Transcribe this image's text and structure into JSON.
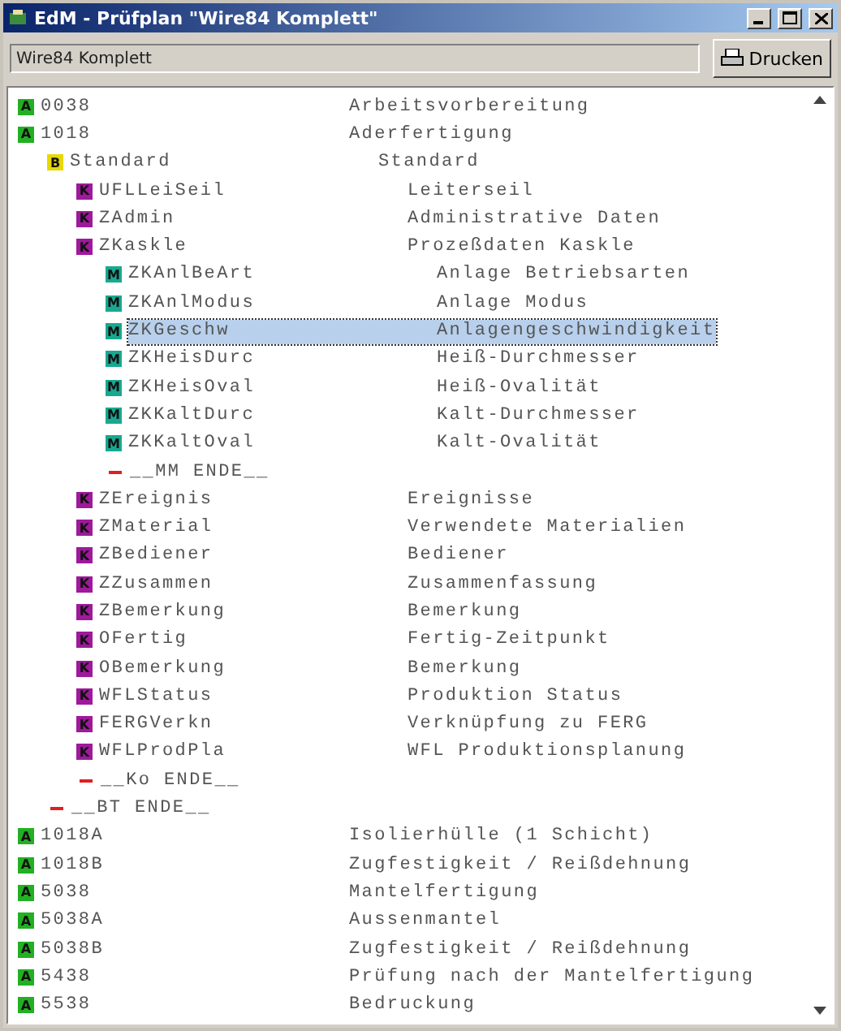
{
  "window": {
    "title": "EdM - Prüfplan \"Wire84 Komplett\""
  },
  "toolbar": {
    "field_value": "Wire84 Komplett",
    "print_button": "Drucken"
  },
  "tree": [
    {
      "kind": "node",
      "badge": "A",
      "color": "#22b022",
      "name": "0038",
      "description": "Arbeitsvorbereitung",
      "selected": false
    },
    {
      "kind": "node",
      "badge": "A",
      "color": "#22b022",
      "name": "1018",
      "description": "Aderfertigung",
      "selected": false,
      "children": [
        {
          "kind": "node",
          "badge": "B",
          "color": "#e6d800",
          "name": "Standard",
          "description": "Standard",
          "selected": false,
          "children": [
            {
              "kind": "node",
              "badge": "K",
              "color": "#a0189c",
              "name": "UFLLeiSeil",
              "description": "Leiterseil",
              "selected": false
            },
            {
              "kind": "node",
              "badge": "K",
              "color": "#a0189c",
              "name": "ZAdmin",
              "description": "Administrative Daten",
              "selected": false
            },
            {
              "kind": "node",
              "badge": "K",
              "color": "#a0189c",
              "name": "ZKaskle",
              "description": "Prozeßdaten Kaskle",
              "selected": false,
              "children": [
                {
                  "kind": "node",
                  "badge": "M",
                  "color": "#18a890",
                  "name": "ZKAnlBeArt",
                  "description": "Anlage Betriebsarten",
                  "selected": false
                },
                {
                  "kind": "node",
                  "badge": "M",
                  "color": "#18a890",
                  "name": "ZKAnlModus",
                  "description": "Anlage Modus",
                  "selected": false
                },
                {
                  "kind": "node",
                  "badge": "M",
                  "color": "#18a890",
                  "name": "ZKGeschw",
                  "description": "Anlagengeschwindigkeit",
                  "selected": true
                },
                {
                  "kind": "node",
                  "badge": "M",
                  "color": "#18a890",
                  "name": "ZKHeisDurc",
                  "description": "Heiß-Durchmesser",
                  "selected": false
                },
                {
                  "kind": "node",
                  "badge": "M",
                  "color": "#18a890",
                  "name": "ZKHeisOval",
                  "description": "Heiß-Ovalität",
                  "selected": false
                },
                {
                  "kind": "node",
                  "badge": "M",
                  "color": "#18a890",
                  "name": "ZKKaltDurc",
                  "description": "Kalt-Durchmesser",
                  "selected": false
                },
                {
                  "kind": "node",
                  "badge": "M",
                  "color": "#18a890",
                  "name": "ZKKaltOval",
                  "description": "Kalt-Ovalität",
                  "selected": false
                },
                {
                  "kind": "end",
                  "name": "__MM ENDE__",
                  "selected": false
                }
              ]
            },
            {
              "kind": "node",
              "badge": "K",
              "color": "#a0189c",
              "name": "ZEreignis",
              "description": "Ereignisse",
              "selected": false
            },
            {
              "kind": "node",
              "badge": "K",
              "color": "#a0189c",
              "name": "ZMaterial",
              "description": "Verwendete Materialien",
              "selected": false
            },
            {
              "kind": "node",
              "badge": "K",
              "color": "#a0189c",
              "name": "ZBediener",
              "description": "Bediener",
              "selected": false
            },
            {
              "kind": "node",
              "badge": "K",
              "color": "#a0189c",
              "name": "ZZusammen",
              "description": "Zusammenfassung",
              "selected": false
            },
            {
              "kind": "node",
              "badge": "K",
              "color": "#a0189c",
              "name": "ZBemerkung",
              "description": "Bemerkung",
              "selected": false
            },
            {
              "kind": "node",
              "badge": "K",
              "color": "#a0189c",
              "name": "OFertig",
              "description": "Fertig-Zeitpunkt",
              "selected": false
            },
            {
              "kind": "node",
              "badge": "K",
              "color": "#a0189c",
              "name": "OBemerkung",
              "description": "Bemerkung",
              "selected": false
            },
            {
              "kind": "node",
              "badge": "K",
              "color": "#a0189c",
              "name": "WFLStatus",
              "description": "Produktion Status",
              "selected": false
            },
            {
              "kind": "node",
              "badge": "K",
              "color": "#a0189c",
              "name": "FERGVerkn",
              "description": "Verknüpfung zu FERG",
              "selected": false
            },
            {
              "kind": "node",
              "badge": "K",
              "color": "#a0189c",
              "name": "WFLProdPla",
              "description": "WFL Produktionsplanung",
              "selected": false
            },
            {
              "kind": "end",
              "name": "__Ko ENDE__",
              "selected": false
            }
          ]
        },
        {
          "kind": "end",
          "name": "__BT ENDE__",
          "selected": false
        }
      ]
    },
    {
      "kind": "node",
      "badge": "A",
      "color": "#22b022",
      "name": "1018A",
      "description": "Isolierhülle (1 Schicht)",
      "selected": false
    },
    {
      "kind": "node",
      "badge": "A",
      "color": "#22b022",
      "name": "1018B",
      "description": "Zugfestigkeit / Reißdehnung",
      "selected": false
    },
    {
      "kind": "node",
      "badge": "A",
      "color": "#22b022",
      "name": "5038",
      "description": "Mantelfertigung",
      "selected": false
    },
    {
      "kind": "node",
      "badge": "A",
      "color": "#22b022",
      "name": "5038A",
      "description": "Aussenmantel",
      "selected": false
    },
    {
      "kind": "node",
      "badge": "A",
      "color": "#22b022",
      "name": "5038B",
      "description": "Zugfestigkeit / Reißdehnung",
      "selected": false
    },
    {
      "kind": "node",
      "badge": "A",
      "color": "#22b022",
      "name": "5438",
      "description": "Prüfung nach der Mantelfertigung",
      "selected": false
    },
    {
      "kind": "node",
      "badge": "A",
      "color": "#22b022",
      "name": "5538",
      "description": "Bedruckung",
      "selected": false
    }
  ]
}
